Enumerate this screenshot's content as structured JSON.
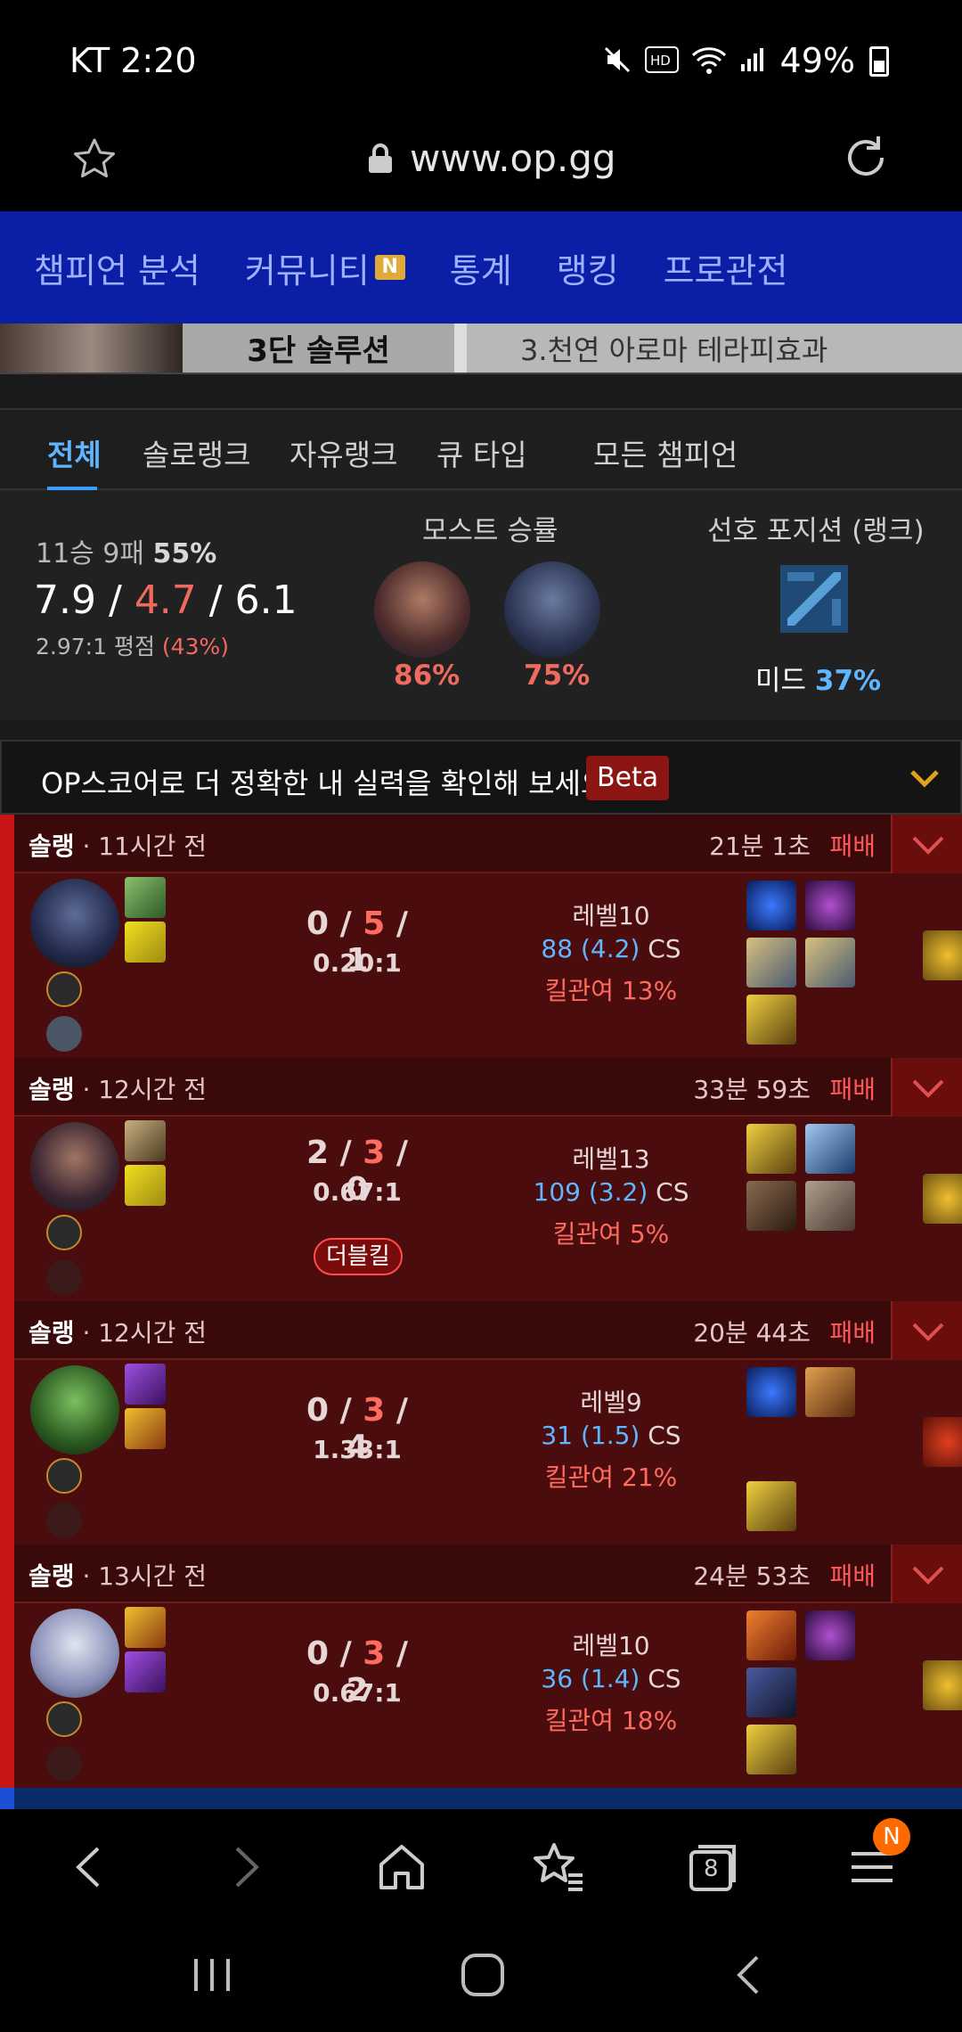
{
  "status": {
    "carrier_time": "KT 2:20",
    "battery": "49%"
  },
  "browser": {
    "url": "www.op.gg",
    "tab_count": "8",
    "menu_badge": "N"
  },
  "nav": {
    "items": [
      "챔피언 분석",
      "커뮤니티",
      "통계",
      "랭킹",
      "프로관전"
    ],
    "community_badge": "N"
  },
  "banner": {
    "text1": "3단 솔루션",
    "text2": "3.천연 아로마 테라피효과"
  },
  "filter_tabs": [
    "전체",
    "솔로랭크",
    "자유랭크",
    "큐 타입",
    "모든 챔피언"
  ],
  "summary": {
    "wl": "11승 9패",
    "winrate": "55%",
    "kda_k": "7.9",
    "kda_d": "4.7",
    "kda_a": "6.1",
    "ratio": "2.97:1 평점",
    "kp": "(43%)",
    "most_title": "모스트 승률",
    "most": [
      {
        "wr": "86%"
      },
      {
        "wr": "75%"
      }
    ],
    "pos_title": "선호 포지션 (랭크)",
    "pos_name": "미드",
    "pos_pct": "37%"
  },
  "opscore": {
    "text": "OP스코어로 더 정확한 내 실력을 확인해 보세요",
    "beta": "Beta"
  },
  "separator": "/",
  "matches": [
    {
      "queue": "솔랭",
      "ago": "· 11시간 전",
      "duration": "21분 1초",
      "result": "패배",
      "k": "0",
      "d": "5",
      "a": "1",
      "ratio": "0.20:1",
      "multikill": "",
      "level": "레벨10",
      "cs_n": "88 (4.2)",
      "cs_label": "CS",
      "kp": "킬관여 13%"
    },
    {
      "queue": "솔랭",
      "ago": "· 12시간 전",
      "duration": "33분 59초",
      "result": "패배",
      "k": "2",
      "d": "3",
      "a": "0",
      "ratio": "0.67:1",
      "multikill": "더블킬",
      "level": "레벨13",
      "cs_n": "109 (3.2)",
      "cs_label": "CS",
      "kp": "킬관여 5%"
    },
    {
      "queue": "솔랭",
      "ago": "· 12시간 전",
      "duration": "20분 44초",
      "result": "패배",
      "k": "0",
      "d": "3",
      "a": "4",
      "ratio": "1.33:1",
      "multikill": "",
      "level": "레벨9",
      "cs_n": "31 (1.5)",
      "cs_label": "CS",
      "kp": "킬관여 21%"
    },
    {
      "queue": "솔랭",
      "ago": "· 13시간 전",
      "duration": "24분 53초",
      "result": "패배",
      "k": "0",
      "d": "3",
      "a": "2",
      "ratio": "0.67:1",
      "multikill": "",
      "level": "레벨10",
      "cs_n": "36 (1.4)",
      "cs_label": "CS",
      "kp": "킬관여 18%"
    }
  ],
  "colors": {
    "nav_bg": "#0a1fa6",
    "loss_bg": "#4a0c0c",
    "loss_accent": "#c81414",
    "blue_text": "#5fb6ff",
    "red_text": "#f06a5f"
  }
}
